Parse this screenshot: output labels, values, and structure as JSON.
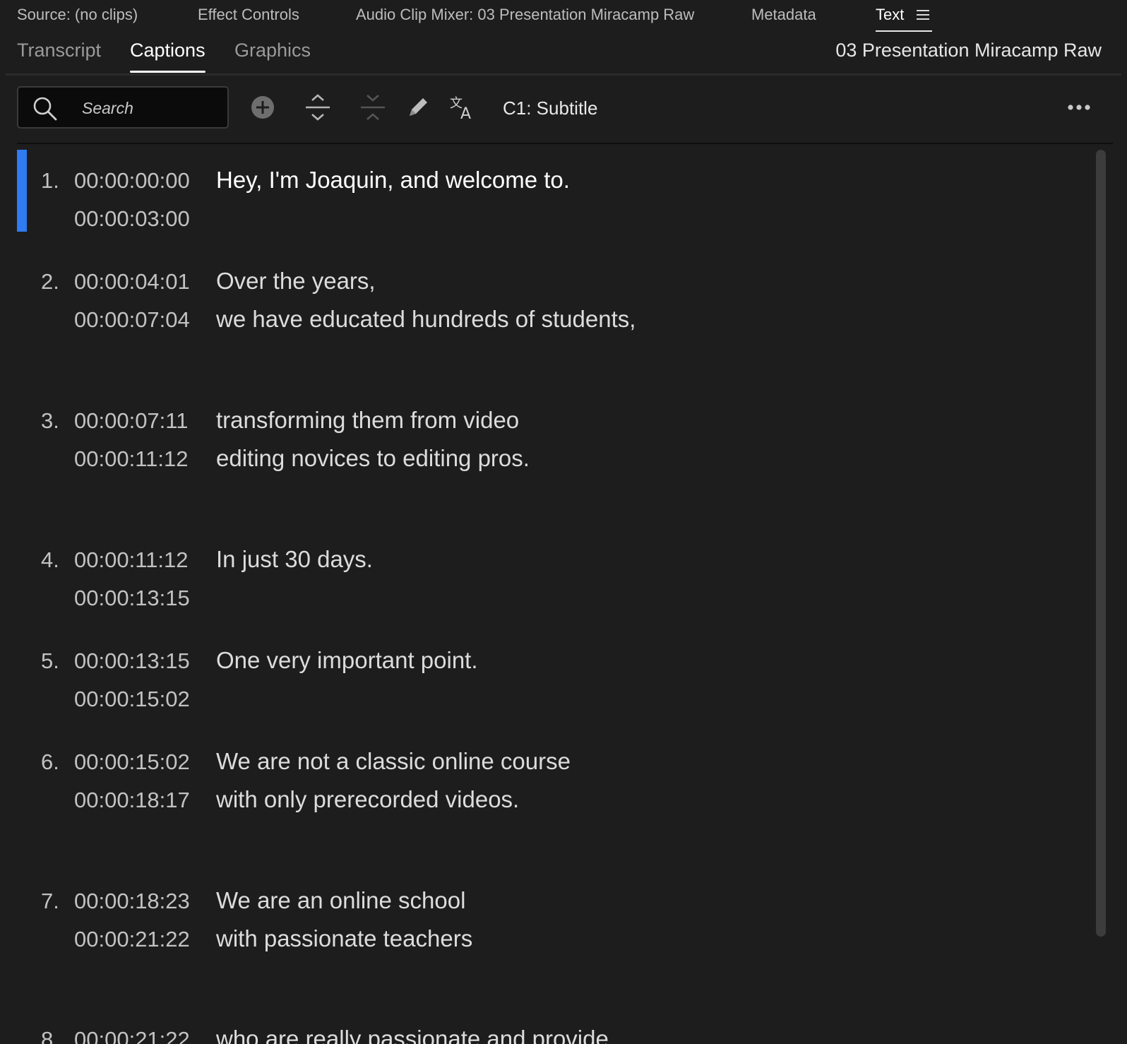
{
  "panel_tabs": {
    "source": "Source: (no clips)",
    "effect_controls": "Effect Controls",
    "audio_clip_mixer": "Audio Clip Mixer: 03 Presentation Miracamp Raw",
    "metadata": "Metadata",
    "text": "Text"
  },
  "sub_tabs": {
    "transcript": "Transcript",
    "captions": "Captions",
    "graphics": "Graphics"
  },
  "sequence_name": "03 Presentation Miracamp Raw",
  "toolbar": {
    "search_placeholder": "Search",
    "track_label": "C1: Subtitle"
  },
  "captions": [
    {
      "num": "1.",
      "in": "00:00:00:00",
      "out": "00:00:03:00",
      "line1": "Hey, I'm Joaquin, and welcome to.",
      "line2": "",
      "selected": true
    },
    {
      "num": "2.",
      "in": "00:00:04:01",
      "out": "00:00:07:04",
      "line1": "Over the years,",
      "line2": "we have educated hundreds of students,"
    },
    {
      "num": "3.",
      "in": "00:00:07:11",
      "out": "00:00:11:12",
      "line1": "transforming them from video",
      "line2": "editing novices to editing pros."
    },
    {
      "num": "4.",
      "in": "00:00:11:12",
      "out": "00:00:13:15",
      "line1": "In just 30 days.",
      "line2": ""
    },
    {
      "num": "5.",
      "in": "00:00:13:15",
      "out": "00:00:15:02",
      "line1": "One very important point.",
      "line2": ""
    },
    {
      "num": "6.",
      "in": "00:00:15:02",
      "out": "00:00:18:17",
      "line1": "We are not a classic online course",
      "line2": "with only prerecorded videos."
    },
    {
      "num": "7.",
      "in": "00:00:18:23",
      "out": "00:00:21:22",
      "line1": "We are an online school",
      "line2": "with passionate teachers"
    },
    {
      "num": "8.",
      "in": "00:00:21:22",
      "out": "",
      "line1": "who are really passionate and provide",
      "line2": ""
    }
  ],
  "colors": {
    "background": "#1d1d1d",
    "selection_accent": "#2e7bf2",
    "search_bg": "#0b0b0b"
  }
}
